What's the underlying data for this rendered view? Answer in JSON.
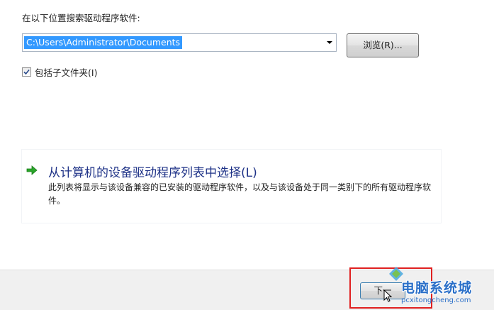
{
  "search": {
    "label": "在以下位置搜索驱动程序软件:",
    "path_value": "C:\\Users\\Administrator\\Documents",
    "browse_label": "浏览(R)...",
    "include_subfolders": {
      "label": "包括子文件夹(I)",
      "checked": true
    }
  },
  "pick_option": {
    "icon": "green-arrow-icon",
    "title": "从计算机的设备驱动程序列表中选择(L)",
    "description": "此列表将显示与该设备兼容的已安装的驱动程序软件，以及与该设备处于同一类别下的所有驱动程序软件。"
  },
  "footer": {
    "next_label": "下一",
    "highlight_color": "#e02020"
  },
  "watermark": {
    "text": "电脑系统城",
    "url": "pcxitongcheng.com"
  },
  "colors": {
    "accent": "#3399ff",
    "link": "#1e3287",
    "arrow": "#2aa52a"
  }
}
